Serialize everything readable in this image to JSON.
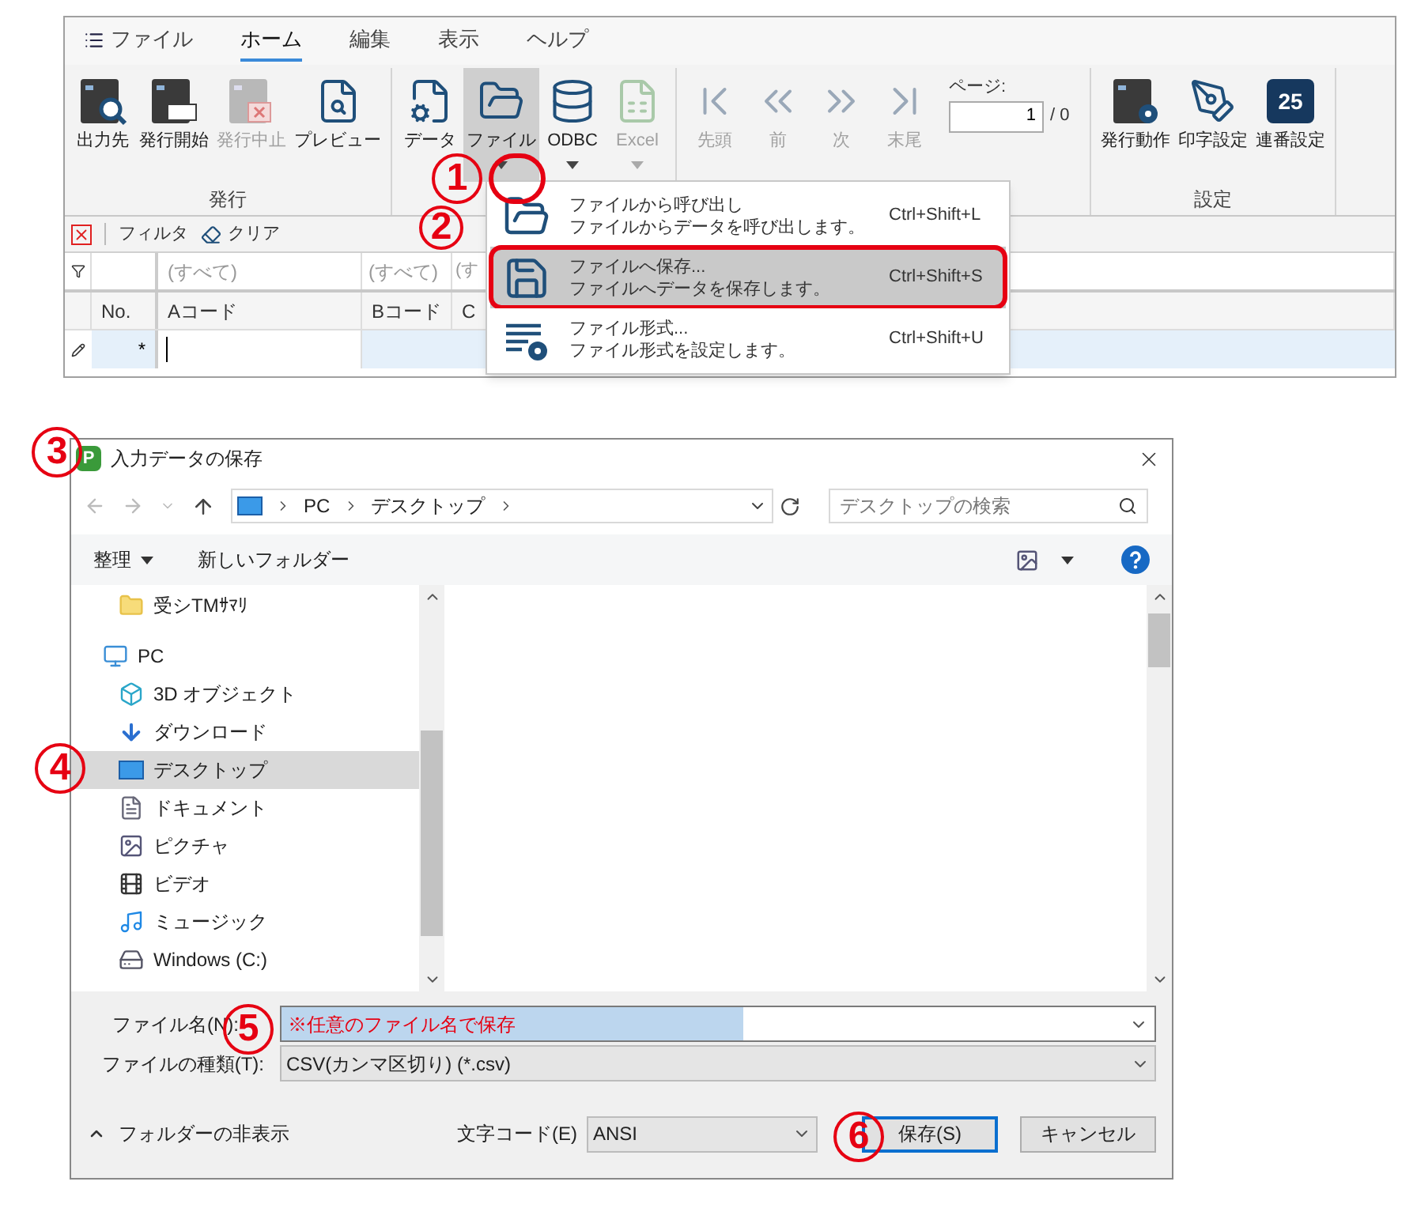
{
  "ribbon": {
    "tabs": [
      {
        "label": "ファイル",
        "kind": "menu",
        "selected": false
      },
      {
        "label": "ホーム",
        "kind": "tab",
        "selected": true
      },
      {
        "label": "編集",
        "kind": "tab",
        "selected": false
      },
      {
        "label": "表示",
        "kind": "tab",
        "selected": false
      },
      {
        "label": "ヘルプ",
        "kind": "tab",
        "selected": false
      }
    ],
    "groups": [
      {
        "kind": "buttons",
        "label": "発行",
        "buttons": [
          {
            "label": "出力先",
            "disabled": false,
            "dropdown": false,
            "pressed": false
          },
          {
            "label": "発行開始",
            "disabled": false,
            "dropdown": false,
            "pressed": false
          },
          {
            "label": "発行中止",
            "disabled": true,
            "dropdown": false,
            "pressed": false
          },
          {
            "label": "プレビュー",
            "disabled": false,
            "dropdown": false,
            "pressed": false
          }
        ]
      },
      {
        "kind": "buttons",
        "buttons": [
          {
            "label": "データ",
            "disabled": false,
            "dropdown": false,
            "pressed": false
          },
          {
            "label": "ファイル",
            "disabled": false,
            "dropdown": true,
            "pressed": true
          },
          {
            "label": "ODBC",
            "disabled": false,
            "dropdown": true,
            "pressed": false
          },
          {
            "label": "Excel",
            "disabled": true,
            "dropdown": true,
            "pressed": false
          }
        ]
      },
      {
        "kind": "nav",
        "buttons": [
          {
            "label": "先頭",
            "disabled": true,
            "dropdown": false,
            "pressed": false
          },
          {
            "label": "前",
            "disabled": true,
            "dropdown": false,
            "pressed": false
          },
          {
            "label": "次",
            "disabled": true,
            "dropdown": false,
            "pressed": false
          },
          {
            "label": "末尾",
            "disabled": true,
            "dropdown": false,
            "pressed": false
          }
        ],
        "page_label": "ページ:",
        "page_value": "1",
        "page_total": "/ 0"
      },
      {
        "kind": "buttons",
        "label": "設定",
        "buttons": [
          {
            "label": "発行動作",
            "disabled": false,
            "dropdown": false,
            "pressed": false
          },
          {
            "label": "印字設定",
            "disabled": false,
            "dropdown": false,
            "pressed": false
          },
          {
            "label": "連番設定",
            "icon_text": "25",
            "disabled": false,
            "dropdown": false,
            "pressed": false
          }
        ]
      }
    ]
  },
  "menu": {
    "items": [
      {
        "title": "ファイルから呼び出し",
        "description": "ファイルからデータを呼び出します。",
        "shortcut": "Ctrl+Shift+L",
        "selected": false
      },
      {
        "title": "ファイルへ保存...",
        "description": "ファイルへデータを保存します。",
        "shortcut": "Ctrl+Shift+S",
        "selected": true
      },
      {
        "title": "ファイル形式...",
        "description": "ファイル形式を設定します。",
        "shortcut": "Ctrl+Shift+U",
        "selected": false
      }
    ]
  },
  "filter_bar": {
    "label": "フィルタ",
    "clear": "クリア"
  },
  "grid": {
    "filter_row": [
      "(すべて)",
      "(すべて)",
      "(す"
    ],
    "columns": [
      "No.",
      "Aコード",
      "Bコード",
      "C"
    ],
    "new_row_marker": "*"
  },
  "dialog": {
    "app_icon": "P",
    "title": "入力データの保存",
    "address": [
      "PC",
      "デスクトップ"
    ],
    "search_placeholder": "デスクトップの検索",
    "toolbar": {
      "organize": "整理",
      "new_folder": "新しいフォルダー"
    },
    "tree": [
      {
        "label": "受シTMｻﾏﾘ",
        "selected": false
      },
      {
        "label": "PC",
        "selected": false,
        "children": [
          {
            "label": "3D オブジェクト",
            "selected": false
          },
          {
            "label": "ダウンロード",
            "selected": false
          },
          {
            "label": "デスクトップ",
            "selected": true
          },
          {
            "label": "ドキュメント",
            "selected": false
          },
          {
            "label": "ピクチャ",
            "selected": false
          },
          {
            "label": "ビデオ",
            "selected": false
          },
          {
            "label": "ミュージック",
            "selected": false
          },
          {
            "label": "Windows (C:)",
            "selected": false
          }
        ]
      }
    ],
    "file_name": {
      "label": "ファイル名(N):",
      "value": "※任意のファイル名で保存"
    },
    "file_type": {
      "label": "ファイルの種類(T):",
      "value": "CSV(カンマ区切り) (*.csv)"
    },
    "hide_folders": "フォルダーの非表示",
    "encoding": {
      "label": "文字コード(E)",
      "value": "ANSI"
    },
    "buttons": [
      {
        "label": "保存(S)",
        "default": true
      },
      {
        "label": "キャンセル",
        "default": false
      }
    ]
  },
  "annotations": [
    "1",
    "2",
    "3",
    "4",
    "5",
    "6"
  ]
}
